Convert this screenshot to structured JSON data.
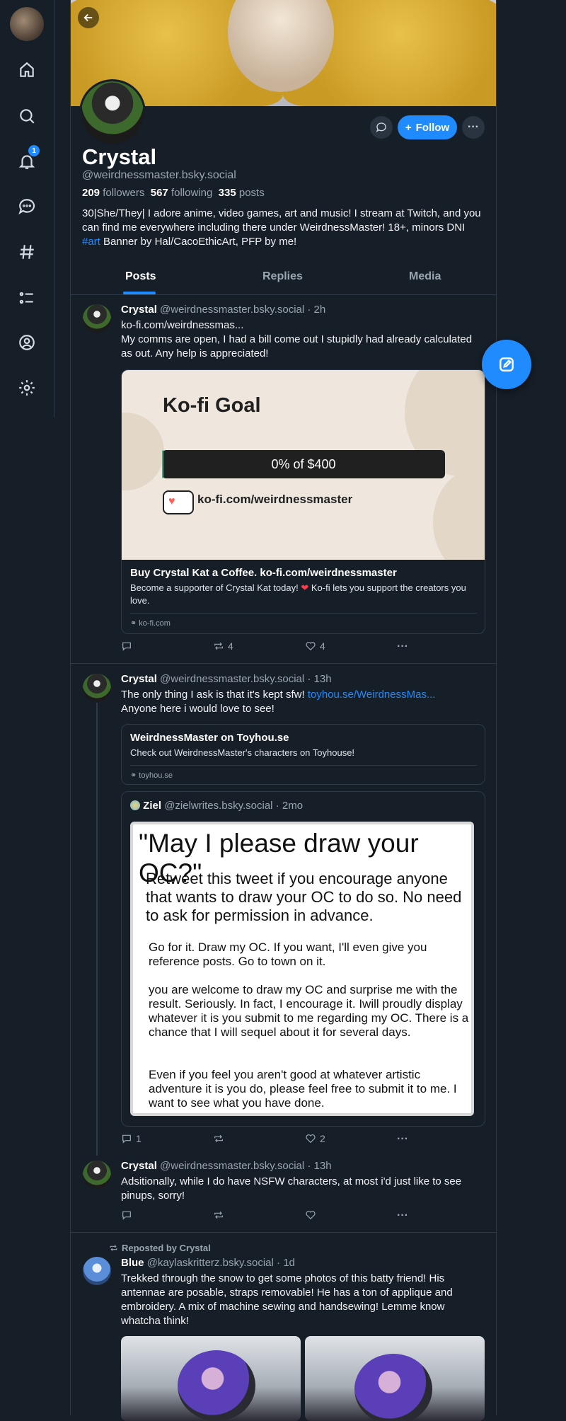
{
  "sidebar": {
    "notifications_badge": "1"
  },
  "profile": {
    "display_name": "Crystal",
    "handle": "@weirdnessmaster.bsky.social",
    "followers_count": "209",
    "followers_label": "followers",
    "following_count": "567",
    "following_label": "following",
    "posts_count": "335",
    "posts_label": "posts",
    "bio_main": "30|She/They| I adore anime, video games, art and music! I stream at Twitch, and you can find me everywhere including there under WeirdnessMaster! 18+, minors DNI ",
    "bio_tag": "#art",
    "bio_end": " Banner by Hal/CacoEthicArt, PFP by me!",
    "follow_label": "Follow"
  },
  "tabs": [
    "Posts",
    "Replies",
    "Media"
  ],
  "posts": [
    {
      "author": "Crystal",
      "handle": "@weirdnessmaster.bsky.social",
      "time": "· 2h",
      "link": "ko-fi.com/weirdnessmas...",
      "text": "My comms are open, I had a bill come out I stupidly had already calculated as out. Any help is appreciated!",
      "embed": {
        "image_title": "Ko-fi Goal",
        "goal_text": "0% of $400",
        "goal_progress": 0.005,
        "image_url": "ko-fi.com/weirdnessmaster",
        "title": "Buy Crystal Kat a Coffee. ko-fi.com/weirdnessmaster",
        "desc1": "Become a supporter of Crystal Kat today!",
        "desc2": " Ko-fi lets you support the creators you love.",
        "domain": "ko-fi.com"
      },
      "replies": "",
      "reposts": "4",
      "likes": "4"
    },
    {
      "author": "Crystal",
      "handle": "@weirdnessmaster.bsky.social",
      "time": "· 13h",
      "text_a": "The only thing I ask is that it's kept sfw! ",
      "link": "toyhou.se/WeirdnessMas...",
      "text_b": "Anyone here i would love to see!",
      "embed": {
        "title": "WeirdnessMaster on Toyhou.se",
        "desc": "Check out WeirdnessMaster's characters on Toyhouse!",
        "domain": "toyhou.se"
      },
      "quote": {
        "author": "Ziel",
        "handle": "@zielwrites.bsky.social",
        "time": "· 2mo",
        "img_title": "\"May I please draw your OC?\"",
        "img_sub": "Retweet this tweet if you encourage anyone that wants to draw your OC to do so. No need to ask for permission in advance.",
        "img_p1": "Go for it. Draw my OC. If you want, I'll even give you reference posts. Go to town on it.",
        "img_p2": "you are welcome to draw my OC and surprise me with the result. Seriously. In fact, I encourage it. Iwill proudly display whatever it is you submit to me regarding my OC. There is a chance that I will sequel about it for several days.",
        "img_p3": "Even if you feel you aren't good at whatever artistic adventure it is you do, please feel free to submit it to me. I want to see what you have done."
      },
      "replies": "1",
      "reposts": "",
      "likes": "2"
    },
    {
      "author": "Crystal",
      "handle": "@weirdnessmaster.bsky.social",
      "time": "· 13h",
      "text": "Adsitionally, while I do have NSFW characters, at most i'd just like to see pinups, sorry!",
      "replies": "",
      "reposts": "",
      "likes": ""
    },
    {
      "repost_label": "Reposted by Crystal",
      "author": "Blue",
      "handle": "@kaylaskritterz.bsky.social",
      "time": "· 1d",
      "text": "Trekked through the snow to get some photos of this batty friend! His antennae are posable, straps removable! He has a ton of applique and embroidery. A mix of machine sewing and handsewing! Lemme know whatcha think!"
    }
  ],
  "colors": {
    "background": "#161e27",
    "accent": "#208bfe",
    "muted": "#9aa5b1",
    "border": "#2e3a48"
  }
}
